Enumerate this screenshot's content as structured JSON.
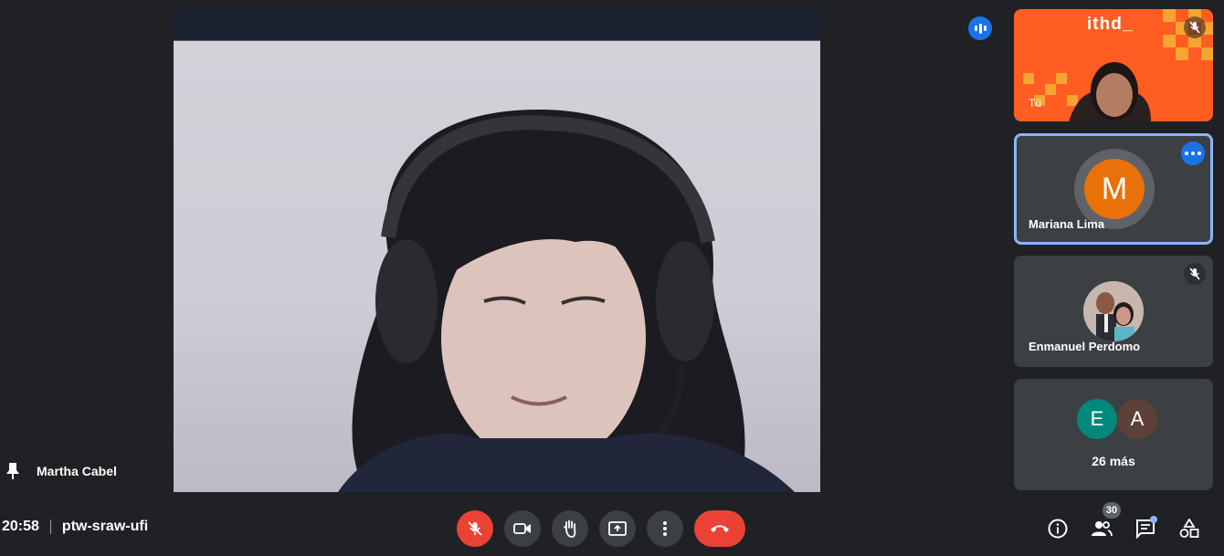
{
  "main_video": {
    "participant": "Martha Cabel"
  },
  "tiles": {
    "self": {
      "label": "Tú",
      "logo_text": "ithd_"
    },
    "mariana": {
      "name": "Mariana Lima",
      "initial": "M",
      "avatar_color": "#e8710a"
    },
    "enmanuel": {
      "name": "Enmanuel Perdomo"
    },
    "more": {
      "initials": [
        "E",
        "A"
      ],
      "avatar_colors": [
        "#00897b",
        "#5d4037"
      ],
      "label": "26 más"
    }
  },
  "meeting": {
    "time": "20:58",
    "code": "ptw-sraw-ufi"
  },
  "controls": [
    "mic-off",
    "camera",
    "raise-hand",
    "present",
    "more-options",
    "leave-call"
  ],
  "right_controls": {
    "participants_count": "30"
  },
  "colors": {
    "accent": "#1a73e8",
    "danger": "#ea4335",
    "self_tile": "#ff5d21",
    "background": "#202124"
  }
}
